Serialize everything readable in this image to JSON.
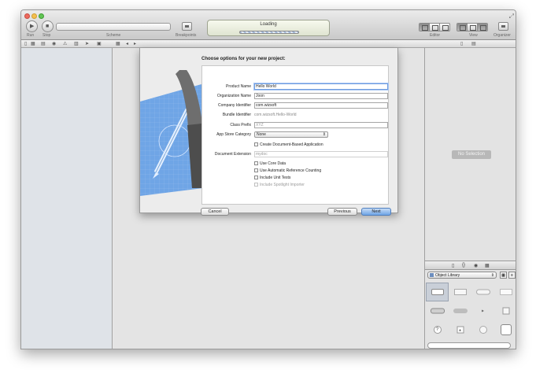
{
  "toolbar": {
    "run_label": "Run",
    "stop_label": "Stop",
    "scheme_label": "Scheme",
    "breakpoints_label": "Breakpoints",
    "activity_text": "Loading",
    "activity_progress": 0.5,
    "editor_label": "Editor",
    "view_label": "View",
    "organizer_label": "Organizer"
  },
  "utilities": {
    "no_selection": "No Selection",
    "library_select": "Object Library"
  },
  "sheet": {
    "title": "Choose options for your new project:",
    "fields": {
      "product_name": {
        "label": "Product Name",
        "value": "Hello World"
      },
      "organization_name": {
        "label": "Organization Name",
        "value": "Joon"
      },
      "company_identifier": {
        "label": "Company Identifier",
        "value": "com.wizsoft"
      },
      "bundle_identifier": {
        "label": "Bundle Identifier",
        "value": "com.wizsoft.Hello-World"
      },
      "class_prefix": {
        "label": "Class Prefix",
        "placeholder": "XYZ"
      },
      "app_store_category": {
        "label": "App Store Category",
        "value": "None"
      },
      "document_extension": {
        "label": "Document Extension",
        "placeholder": "mydoc"
      }
    },
    "checkboxes": {
      "document_based": "Create Document-Based Application",
      "core_data": "Use Core Data",
      "arc": "Use Automatic Reference Counting",
      "unit_tests": "Include Unit Tests",
      "spotlight": "Include Spotlight Importer"
    },
    "buttons": {
      "cancel": "Cancel",
      "previous": "Previous",
      "next": "Next"
    }
  },
  "colors": {
    "primary_button": "#6ea4e6",
    "focus_ring": "#a9c6f2"
  }
}
